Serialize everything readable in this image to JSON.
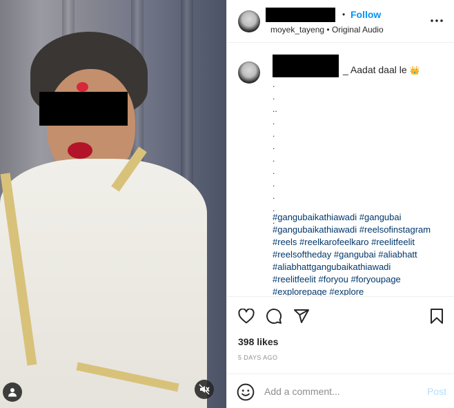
{
  "header": {
    "separator": "•",
    "follow_label": "Follow",
    "username": "moyek_tayeng",
    "separator2": "•",
    "audio": "Original Audio",
    "more_icon": "more-horizontal-icon"
  },
  "caption": {
    "text": "_ Aadat daal le",
    "crown_emoji": "👑",
    "dots": [
      ".",
      ".",
      "..",
      ".",
      ".",
      ".",
      ".",
      ".",
      ".",
      ".",
      ".",
      "."
    ],
    "hashtags": [
      "#gangubaikathiawadi",
      "#gangubai",
      "#gangubaikathiawadi",
      "#reelsofinstagram",
      "#reels",
      "#reelkarofeelkaro",
      "#reelitfeelit",
      "#reelsoftheday",
      "#gangubai",
      "#aliabhatt",
      "#aliabhattgangubaikathiawadi",
      "#reelitfeelit",
      "#foryou",
      "#foryoupage",
      "#explorepage",
      "#explore"
    ]
  },
  "actions": {
    "icons": [
      "heart-icon",
      "comment-icon",
      "share-icon",
      "bookmark-icon"
    ]
  },
  "stats": {
    "likes": "398 likes",
    "date": "5 DAYS AGO"
  },
  "comment_box": {
    "placeholder": "Add a comment...",
    "post_label": "Post"
  },
  "colors": {
    "accent": "#0095f6",
    "hashtag": "#00376b",
    "post_disabled": "#b2dffc"
  }
}
